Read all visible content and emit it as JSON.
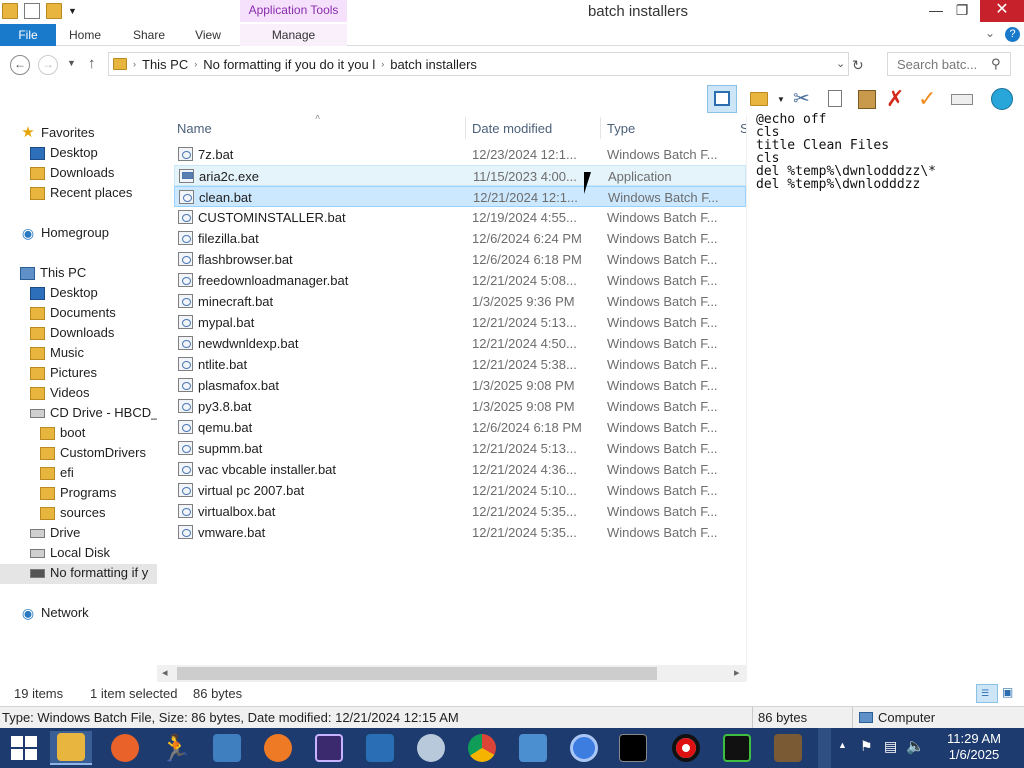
{
  "window": {
    "title": "batch installers",
    "context_tab_group": "Application Tools",
    "minimize_icon": "minimize-icon",
    "restore_icon": "restore-icon",
    "close_icon": "close-icon"
  },
  "ribbon": {
    "tabs": [
      "File",
      "Home",
      "Share",
      "View",
      "Manage"
    ]
  },
  "address": {
    "crumbs": [
      "This PC",
      "No formatting if you do it you l",
      "batch installers"
    ],
    "search_placeholder": "Search batc..."
  },
  "nav": {
    "favorites": "Favorites",
    "fav_items": [
      "Desktop",
      "Downloads",
      "Recent places"
    ],
    "homegroup": "Homegroup",
    "this_pc": "This PC",
    "pc_items": [
      "Desktop",
      "Documents",
      "Downloads",
      "Music",
      "Pictures",
      "Videos",
      "CD Drive - HBCD_"
    ],
    "cd_items": [
      "boot",
      "CustomDrivers",
      "efi",
      "Programs",
      "sources"
    ],
    "drives": [
      "Drive",
      "Local Disk",
      "No formatting if y"
    ],
    "network": "Network"
  },
  "columns": {
    "name": "Name",
    "date": "Date modified",
    "type": "Type",
    "size_partial": "S"
  },
  "files": [
    {
      "name": "7z.bat",
      "date": "12/23/2024 12:1...",
      "type": "Windows Batch F..."
    },
    {
      "name": "aria2c.exe",
      "date": "11/15/2023 4:00...",
      "type": "Application"
    },
    {
      "name": "clean.bat",
      "date": "12/21/2024 12:1...",
      "type": "Windows Batch F..."
    },
    {
      "name": "CUSTOMINSTALLER.bat",
      "date": "12/19/2024 4:55...",
      "type": "Windows Batch F..."
    },
    {
      "name": "filezilla.bat",
      "date": "12/6/2024 6:24 PM",
      "type": "Windows Batch F..."
    },
    {
      "name": "flashbrowser.bat",
      "date": "12/6/2024 6:18 PM",
      "type": "Windows Batch F..."
    },
    {
      "name": "freedownloadmanager.bat",
      "date": "12/21/2024 5:08...",
      "type": "Windows Batch F..."
    },
    {
      "name": "minecraft.bat",
      "date": "1/3/2025 9:36 PM",
      "type": "Windows Batch F..."
    },
    {
      "name": "mypal.bat",
      "date": "12/21/2024 5:13...",
      "type": "Windows Batch F..."
    },
    {
      "name": "newdwnldexp.bat",
      "date": "12/21/2024 4:50...",
      "type": "Windows Batch F..."
    },
    {
      "name": "ntlite.bat",
      "date": "12/21/2024 5:38...",
      "type": "Windows Batch F..."
    },
    {
      "name": "plasmafox.bat",
      "date": "1/3/2025 9:08 PM",
      "type": "Windows Batch F..."
    },
    {
      "name": "py3.8.bat",
      "date": "1/3/2025 9:08 PM",
      "type": "Windows Batch F..."
    },
    {
      "name": "qemu.bat",
      "date": "12/6/2024 6:18 PM",
      "type": "Windows Batch F..."
    },
    {
      "name": "supmm.bat",
      "date": "12/21/2024 5:13...",
      "type": "Windows Batch F..."
    },
    {
      "name": "vac vbcable installer.bat",
      "date": "12/21/2024 4:36...",
      "type": "Windows Batch F..."
    },
    {
      "name": "virtual pc 2007.bat",
      "date": "12/21/2024 5:10...",
      "type": "Windows Batch F..."
    },
    {
      "name": "virtualbox.bat",
      "date": "12/21/2024 5:35...",
      "type": "Windows Batch F..."
    },
    {
      "name": "vmware.bat",
      "date": "12/21/2024 5:35...",
      "type": "Windows Batch F..."
    }
  ],
  "preview_text": "@echo off\ncls\ntitle Clean Files\ncls\ndel %temp%\\dwnlodddzz\\*\ndel %temp%\\dwnlodddzz",
  "status": {
    "items": "19 items",
    "selected": "1 item selected",
    "size": "86 bytes"
  },
  "details": {
    "info": "Type: Windows Batch File, Size: 86 bytes, Date modified: 12/21/2024 12:15 AM",
    "size": "86 bytes",
    "location": "Computer"
  },
  "taskbar": {
    "time": "11:29 AM",
    "date": "1/6/2025",
    "colors": {
      "bar": "#1d3b6e",
      "selection": "#cce8ff",
      "hover": "#e5f3fb",
      "accent": "#1979ca"
    }
  }
}
